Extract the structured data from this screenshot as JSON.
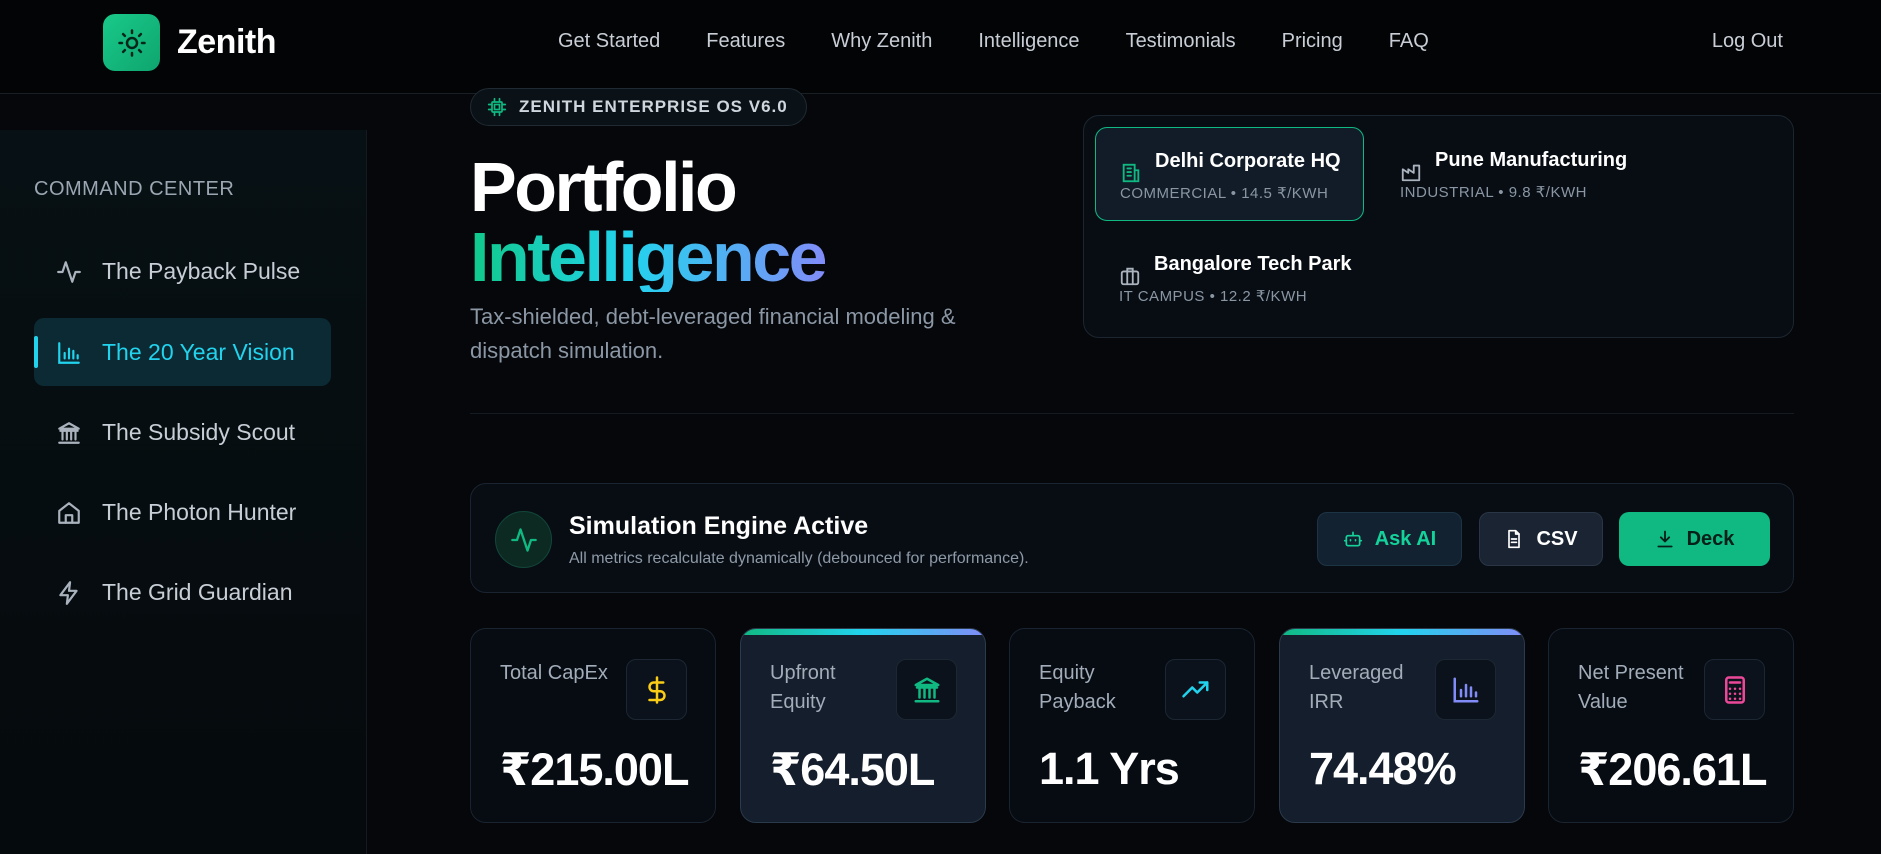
{
  "brand": {
    "name": "Zenith"
  },
  "nav": {
    "links": [
      "Get Started",
      "Features",
      "Why Zenith",
      "Intelligence",
      "Testimonials",
      "Pricing",
      "FAQ"
    ],
    "logout": "Log Out"
  },
  "sidebar": {
    "heading": "COMMAND CENTER",
    "items": [
      {
        "label": "The Payback Pulse",
        "icon": "activity-icon",
        "active": false
      },
      {
        "label": "The 20 Year Vision",
        "icon": "bar-chart-icon",
        "active": true
      },
      {
        "label": "The Subsidy Scout",
        "icon": "bank-icon",
        "active": false
      },
      {
        "label": "The Photon Hunter",
        "icon": "home-icon",
        "active": false
      },
      {
        "label": "The Grid Guardian",
        "icon": "lightning-icon",
        "active": false
      }
    ]
  },
  "hero": {
    "badge": "ZENITH ENTERPRISE OS V6.0",
    "title_line1": "Portfolio",
    "title_line2": "Intelligence",
    "subtitle": "Tax-shielded, debt-leveraged financial modeling & dispatch simulation."
  },
  "sites": [
    {
      "name": "Delhi Corporate HQ",
      "meta": "COMMERCIAL • 14.5 ₹/KWH",
      "icon": "building-icon",
      "active": true
    },
    {
      "name": "Pune Manufacturing",
      "meta": "INDUSTRIAL • 9.8 ₹/KWH",
      "icon": "factory-icon",
      "active": false
    },
    {
      "name": "Bangalore Tech Park",
      "meta": "IT CAMPUS • 12.2 ₹/KWH",
      "icon": "briefcase-icon",
      "active": false
    }
  ],
  "engine": {
    "title": "Simulation Engine Active",
    "subtitle": "All metrics recalculate dynamically (debounced for performance).",
    "buttons": {
      "ask_ai": "Ask AI",
      "csv": "CSV",
      "deck": "Deck"
    }
  },
  "kpis": [
    {
      "label": "Total CapEx",
      "value": "₹215.00L",
      "icon": "dollar-icon",
      "icon_color": "#facc15",
      "highlight": false
    },
    {
      "label": "Upfront Equity",
      "value": "₹64.50L",
      "icon": "bank-icon",
      "icon_color": "#10b981",
      "highlight": true
    },
    {
      "label": "Equity Payback",
      "value": "1.1 Yrs",
      "icon": "trending-up-icon",
      "icon_color": "#22d3ee",
      "highlight": false
    },
    {
      "label": "Leveraged IRR",
      "value": "74.48%",
      "icon": "bar-chart-icon",
      "icon_color": "#818cf8",
      "highlight": true
    },
    {
      "label": "Net Present Value",
      "value": "₹206.61L",
      "icon": "calculator-icon",
      "icon_color": "#ec4899",
      "highlight": false
    }
  ],
  "colors": {
    "accent_green": "#10b981",
    "accent_cyan": "#22d3ee",
    "accent_violet": "#818cf8"
  }
}
